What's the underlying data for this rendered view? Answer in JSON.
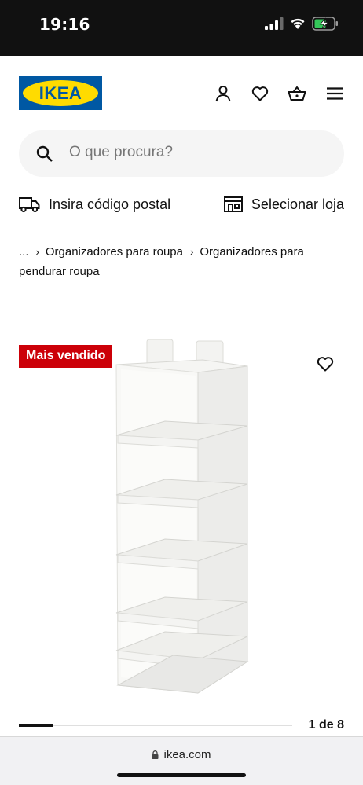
{
  "status_bar": {
    "time": "19:16",
    "icons": [
      "signal-icon",
      "wifi-icon",
      "battery-charging-icon"
    ]
  },
  "header": {
    "logo_text": "IKEA",
    "colors": {
      "brand_blue": "#0058a3",
      "brand_yellow": "#ffdb00"
    },
    "icons": [
      "profile-icon",
      "wishlist-icon",
      "cart-icon",
      "menu-icon"
    ]
  },
  "search": {
    "placeholder": "O que procura?"
  },
  "info_row": {
    "postal_label": "Insira código postal",
    "store_label": "Selecionar loja"
  },
  "breadcrumb": {
    "items": [
      "...",
      "Organizadores para roupa",
      "Organizadores para pendurar roupa"
    ]
  },
  "product": {
    "badge": "Mais vendido",
    "badge_color": "#cc0008"
  },
  "carousel": {
    "counter": "1 de 8",
    "current": 1,
    "total": 8
  },
  "browser": {
    "url": "ikea.com"
  }
}
